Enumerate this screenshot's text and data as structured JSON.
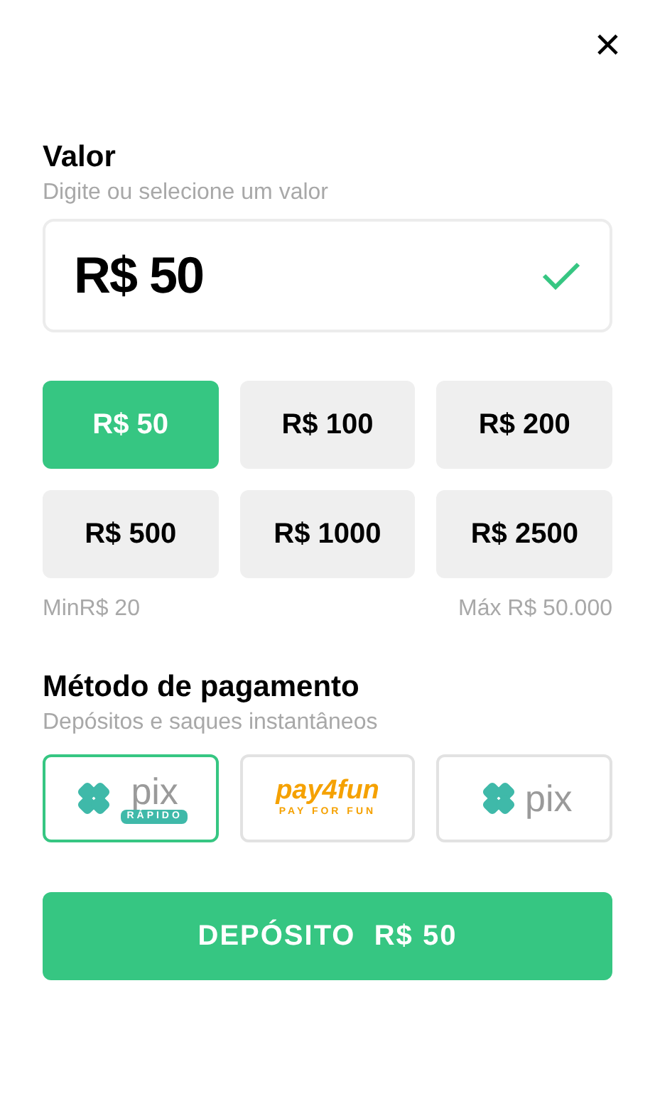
{
  "close_button": {
    "label": "×"
  },
  "amount_section": {
    "title": "Valor",
    "subtitle": "Digite ou selecione um valor",
    "value": "R$ 50",
    "valid": true
  },
  "presets": [
    {
      "label": "R$ 50",
      "selected": true
    },
    {
      "label": "R$ 100",
      "selected": false
    },
    {
      "label": "R$ 200",
      "selected": false
    },
    {
      "label": "R$ 500",
      "selected": false
    },
    {
      "label": "R$ 1000",
      "selected": false
    },
    {
      "label": "R$ 2500",
      "selected": false
    }
  ],
  "limits": {
    "min": "MinR$ 20",
    "max": "Máx R$ 50.000"
  },
  "payment_section": {
    "title": "Método de pagamento",
    "subtitle": "Depósitos e saques instantâneos"
  },
  "methods": [
    {
      "kind": "pix",
      "wordmark": "pix",
      "badge": "RÁPIDO",
      "selected": true
    },
    {
      "kind": "pay4fun",
      "wordmark": "pay4fun",
      "tagline": "PAY FOR FUN",
      "selected": false
    },
    {
      "kind": "pix",
      "wordmark": "pix",
      "selected": false
    }
  ],
  "deposit_button": {
    "label": "DEPÓSITO  R$ 50"
  }
}
